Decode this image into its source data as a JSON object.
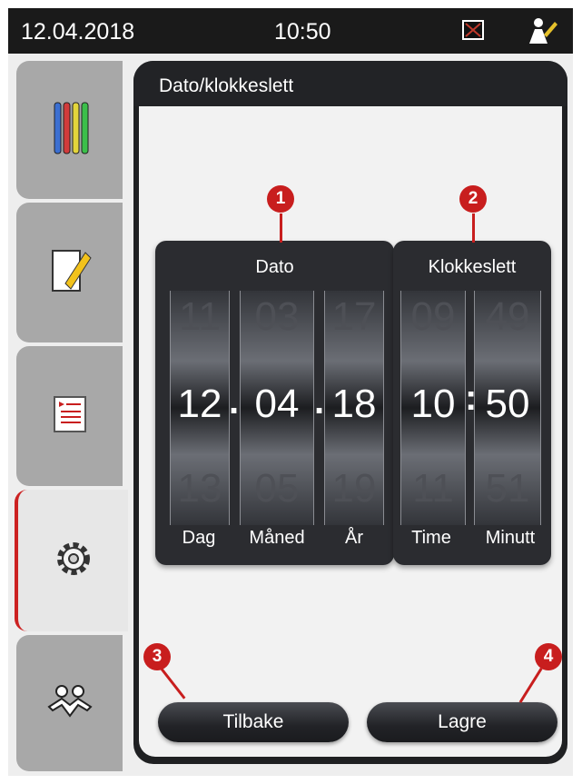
{
  "status_bar": {
    "date": "12.04.2018",
    "time": "10:50"
  },
  "panel": {
    "title": "Dato/klokkeslett"
  },
  "date_picker": {
    "title": "Dato",
    "day": {
      "label": "Dag",
      "prev": "11",
      "value": "12",
      "next": "13"
    },
    "month": {
      "label": "Måned",
      "prev": "03",
      "value": "04",
      "next": "05"
    },
    "year": {
      "label": "År",
      "prev": "17",
      "value": "18",
      "next": "19"
    },
    "separator": "."
  },
  "time_picker": {
    "title": "Klokkeslett",
    "hour": {
      "label": "Time",
      "prev": "09",
      "value": "10",
      "next": "11"
    },
    "minute": {
      "label": "Minutt",
      "prev": "49",
      "value": "50",
      "next": "51"
    },
    "separator": ":"
  },
  "buttons": {
    "back": "Tilbake",
    "save": "Lagre"
  },
  "markers": [
    "1",
    "2",
    "3",
    "4"
  ],
  "colors": {
    "accent": "#c81e1e",
    "sidebar": "#a8a8a8",
    "panel": "#1f2022"
  },
  "icons": [
    "error-icon",
    "user-icon",
    "reagents-icon",
    "notes-icon",
    "report-icon",
    "settings-icon",
    "users-icon"
  ]
}
